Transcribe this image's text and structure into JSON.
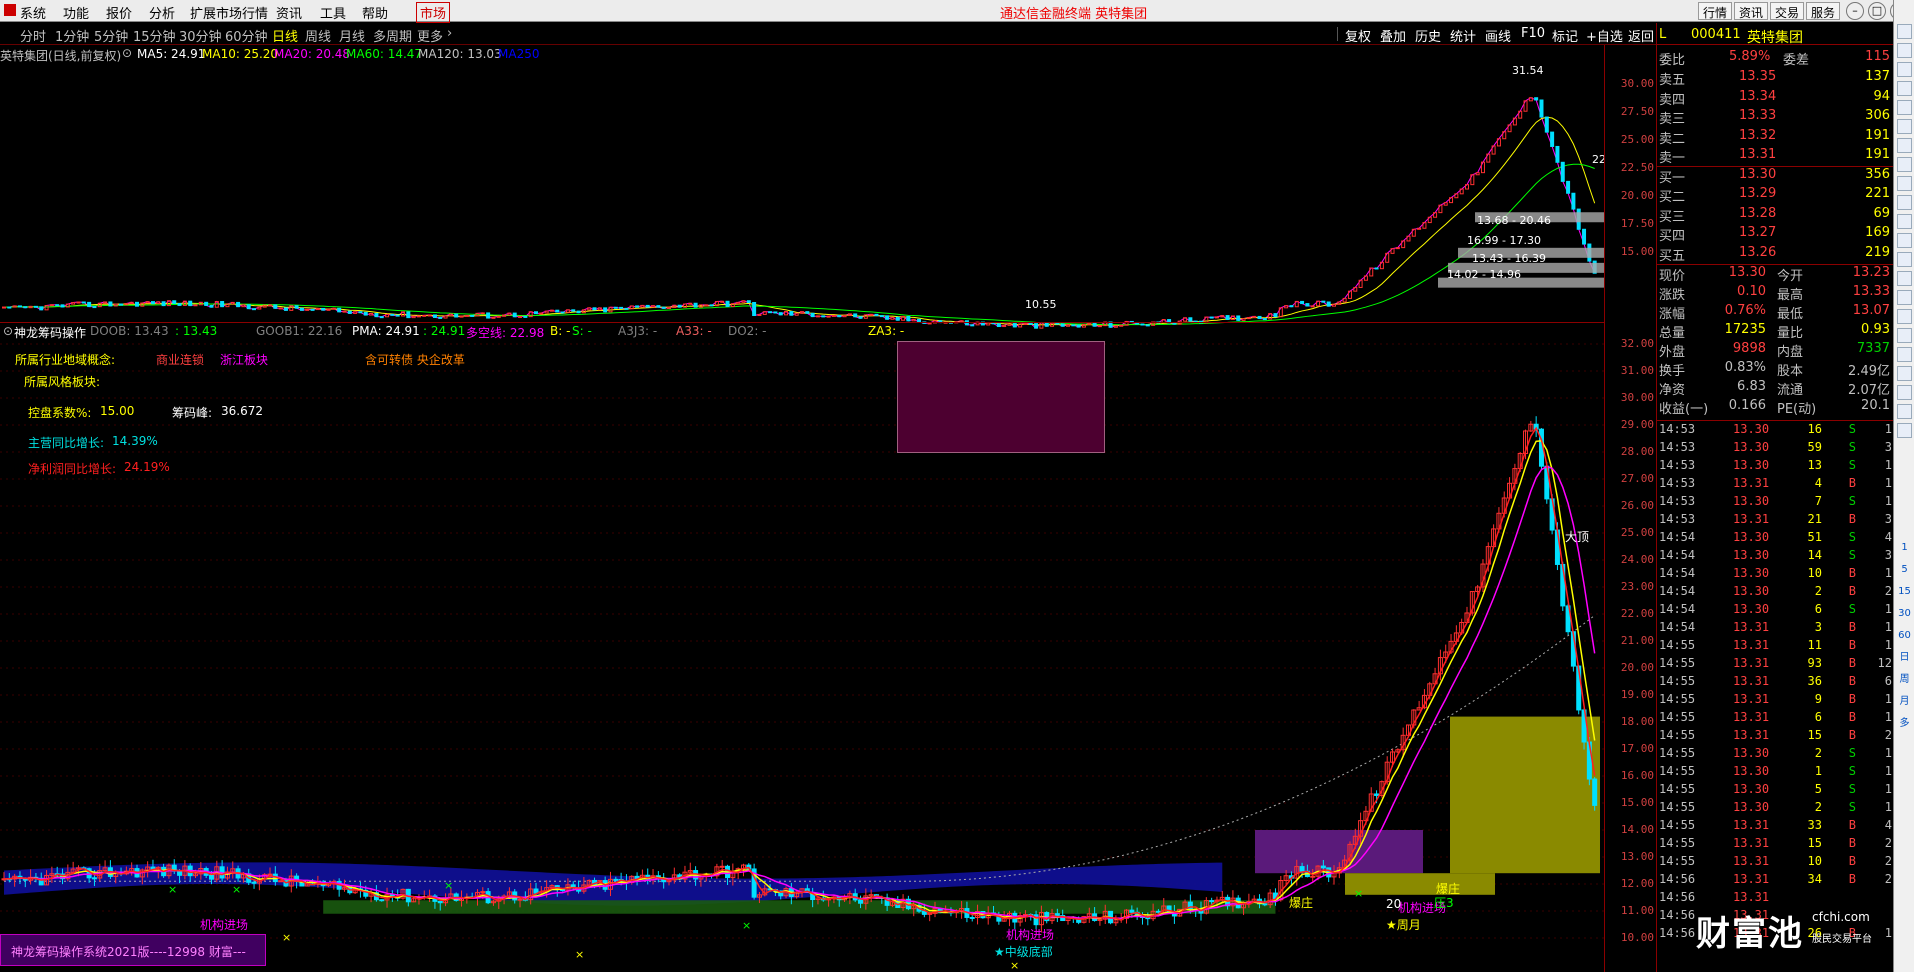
{
  "menubar": {
    "items": [
      "系统",
      "功能",
      "报价",
      "分析",
      "扩展市场行情",
      "资讯",
      "工具",
      "帮助"
    ],
    "active_tab": "市场",
    "app_title": "通达信金融终端  英特集团",
    "right_buttons": [
      "行情",
      "资讯",
      "交易",
      "服务"
    ]
  },
  "periodbar": {
    "periods": [
      "分时",
      "1分钟",
      "5分钟",
      "15分钟",
      "30分钟",
      "60分钟",
      "日线",
      "周线",
      "月线",
      "多周期",
      "更多"
    ],
    "active_period": "日线",
    "tools": [
      "复权",
      "叠加",
      "历史",
      "统计",
      "画线",
      "F10",
      "标记",
      "+自选",
      "返回"
    ]
  },
  "main_legend": {
    "stock": "英特集团(日线,前复权)",
    "ma5": "MA5: 24.91",
    "ma10": "MA10: 25.20",
    "ma20": "MA20: 20.48",
    "ma60": "MA60: 14.47",
    "ma120": "MA120: 13.03",
    "ma250": "MA250",
    "ma_colors": {
      "ma5": "#ffffff",
      "ma10": "#ffff00",
      "ma20": "#ff00ff",
      "ma60": "#00ff00",
      "ma120": "#c0c0c0",
      "ma250": "#0000ff"
    }
  },
  "main_annotations": {
    "high": "31.54",
    "low": "10.55",
    "chip_zones": [
      "13.68 - 20.46",
      "16.99 - 17.30",
      "13.43 - 16.39",
      "14.02 - 14.96"
    ],
    "edge_label": "22"
  },
  "axis_main": [
    "30.00",
    "27.50",
    "25.00",
    "22.50",
    "20.00",
    "17.50",
    "15.00"
  ],
  "indicator_legend": {
    "name": "神龙筹码操作",
    "doob": "DOOB: 13.43",
    "doob2": ": 13.43",
    "goob1": "GOOB1: 22.16",
    "pma": "PMA: 24.91",
    "pma2": ": 24.91",
    "dkx": "多空线: 22.98",
    "b": "B: -",
    "s": "S: -",
    "a3j3": "A3J3: -",
    "a33": "A33: -",
    "do2": "DO2: -",
    "za3": "ZA3: -"
  },
  "info_panel": {
    "industry_label": "所属行业地域概念:",
    "industry_1": "商业连锁",
    "industry_2": "浙江板块",
    "industry_3": "含可转债 央企改革",
    "style_label": "所属风格板块:",
    "control_label": "控盘系数%:",
    "control_value": "15.00",
    "chip_peak_label": "筹码峰:",
    "chip_peak_value": "36.672",
    "revenue_label": "主营同比增长:",
    "revenue_value": "14.39%",
    "profit_label": "净利润同比增长:",
    "profit_value": "24.19%"
  },
  "chart_labels": {
    "jgjc_left": "机构进场",
    "jgjc_mid": "机构进场",
    "zjdb": "★中级底部",
    "zhuang1": "爆庄",
    "zhuang2": "爆庄",
    "jgjc_right": "机构进场",
    "zhouyue": "★周月",
    "num20": "20",
    "ding": "大顶",
    "ya3": "压3"
  },
  "axis_indicator": [
    "32.00",
    "31.00",
    "30.00",
    "29.00",
    "28.00",
    "27.00",
    "26.00",
    "25.00",
    "24.00",
    "23.00",
    "22.00",
    "21.00",
    "20.00",
    "19.00",
    "18.00",
    "17.00",
    "16.00",
    "15.00",
    "14.00",
    "13.00",
    "12.00",
    "11.00",
    "10.00"
  ],
  "footer": "神龙筹码操作系统2021版----12998 财富---",
  "quote_panel": {
    "flag": "L",
    "code": "000411",
    "name": "英特集团",
    "weibi_label": "委比",
    "weibi": "5.89%",
    "weicha_label": "委差",
    "weicha": "115",
    "asks": [
      {
        "label": "卖五",
        "price": "13.35",
        "vol": "137"
      },
      {
        "label": "卖四",
        "price": "13.34",
        "vol": "94"
      },
      {
        "label": "卖三",
        "price": "13.33",
        "vol": "306"
      },
      {
        "label": "卖二",
        "price": "13.32",
        "vol": "191"
      },
      {
        "label": "卖一",
        "price": "13.31",
        "vol": "191"
      }
    ],
    "bids": [
      {
        "label": "买一",
        "price": "13.30",
        "vol": "356"
      },
      {
        "label": "买二",
        "price": "13.29",
        "vol": "221"
      },
      {
        "label": "买三",
        "price": "13.28",
        "vol": "69"
      },
      {
        "label": "买四",
        "price": "13.27",
        "vol": "169"
      },
      {
        "label": "买五",
        "price": "13.26",
        "vol": "219"
      }
    ],
    "stats": [
      {
        "l1": "现价",
        "v1": "13.30",
        "l2": "今开",
        "v2": "13.23"
      },
      {
        "l1": "涨跌",
        "v1": "0.10",
        "l2": "最高",
        "v2": "13.33"
      },
      {
        "l1": "涨幅",
        "v1": "0.76%",
        "l2": "最低",
        "v2": "13.07"
      },
      {
        "l1": "总量",
        "v1": "17235",
        "l2": "量比",
        "v2": "0.93"
      },
      {
        "l1": "外盘",
        "v1": "9898",
        "l2": "内盘",
        "v2": "7337"
      },
      {
        "l1": "换手",
        "v1": "0.83%",
        "l2": "股本",
        "v2": "2.49亿"
      },
      {
        "l1": "净资",
        "v1": "6.83",
        "l2": "流通",
        "v2": "2.07亿"
      },
      {
        "l1": "收益(一)",
        "v1": "0.166",
        "l2": "PE(动)",
        "v2": "20.1"
      }
    ],
    "ticks": [
      {
        "t": "14:53",
        "p": "13.30",
        "v": "16",
        "bs": "S",
        "n": "1"
      },
      {
        "t": "14:53",
        "p": "13.30",
        "v": "59",
        "bs": "S",
        "n": "3"
      },
      {
        "t": "14:53",
        "p": "13.30",
        "v": "13",
        "bs": "S",
        "n": "1"
      },
      {
        "t": "14:53",
        "p": "13.31",
        "v": "4",
        "bs": "B",
        "n": "1"
      },
      {
        "t": "14:53",
        "p": "13.30",
        "v": "7",
        "bs": "S",
        "n": "1"
      },
      {
        "t": "14:53",
        "p": "13.31",
        "v": "21",
        "bs": "B",
        "n": "3"
      },
      {
        "t": "14:54",
        "p": "13.30",
        "v": "51",
        "bs": "S",
        "n": "4"
      },
      {
        "t": "14:54",
        "p": "13.30",
        "v": "14",
        "bs": "S",
        "n": "3"
      },
      {
        "t": "14:54",
        "p": "13.30",
        "v": "10",
        "bs": "B",
        "n": "1"
      },
      {
        "t": "14:54",
        "p": "13.30",
        "v": "2",
        "bs": "B",
        "n": "2"
      },
      {
        "t": "14:54",
        "p": "13.30",
        "v": "6",
        "bs": "S",
        "n": "1"
      },
      {
        "t": "14:54",
        "p": "13.31",
        "v": "3",
        "bs": "B",
        "n": "1"
      },
      {
        "t": "14:55",
        "p": "13.31",
        "v": "11",
        "bs": "B",
        "n": "1"
      },
      {
        "t": "14:55",
        "p": "13.31",
        "v": "93",
        "bs": "B",
        "n": "12"
      },
      {
        "t": "14:55",
        "p": "13.31",
        "v": "36",
        "bs": "B",
        "n": "6"
      },
      {
        "t": "14:55",
        "p": "13.31",
        "v": "9",
        "bs": "B",
        "n": "1"
      },
      {
        "t": "14:55",
        "p": "13.31",
        "v": "6",
        "bs": "B",
        "n": "1"
      },
      {
        "t": "14:55",
        "p": "13.31",
        "v": "15",
        "bs": "B",
        "n": "2"
      },
      {
        "t": "14:55",
        "p": "13.30",
        "v": "2",
        "bs": "S",
        "n": "1"
      },
      {
        "t": "14:55",
        "p": "13.30",
        "v": "1",
        "bs": "S",
        "n": "1"
      },
      {
        "t": "14:55",
        "p": "13.30",
        "v": "5",
        "bs": "S",
        "n": "1"
      },
      {
        "t": "14:55",
        "p": "13.30",
        "v": "2",
        "bs": "S",
        "n": "1"
      },
      {
        "t": "14:55",
        "p": "13.31",
        "v": "33",
        "bs": "B",
        "n": "4"
      },
      {
        "t": "14:55",
        "p": "13.31",
        "v": "15",
        "bs": "B",
        "n": "2"
      },
      {
        "t": "14:55",
        "p": "13.31",
        "v": "10",
        "bs": "B",
        "n": "2"
      },
      {
        "t": "14:56",
        "p": "13.31",
        "v": "34",
        "bs": "B",
        "n": "2"
      },
      {
        "t": "14:56",
        "p": "13.31",
        "v": "",
        "bs": "",
        "n": ""
      },
      {
        "t": "14:56",
        "p": "13.31",
        "v": "",
        "bs": "",
        "n": ""
      },
      {
        "t": "14:56",
        "p": "13.31",
        "v": "26",
        "bs": "B",
        "n": "1"
      }
    ]
  },
  "toolstrip": [
    "1",
    "5",
    "15",
    "30",
    "60",
    "日",
    "周",
    "月",
    "多"
  ],
  "watermark": {
    "brand": "财富池",
    "url": "cfchi.com",
    "sub": "股民交易平台"
  },
  "colors": {
    "up": "#ff3030",
    "down": "#00ffff",
    "up_text": "#ff4040",
    "down_text": "#00d000",
    "yellow": "#ffff00",
    "magenta": "#ff00ff"
  }
}
